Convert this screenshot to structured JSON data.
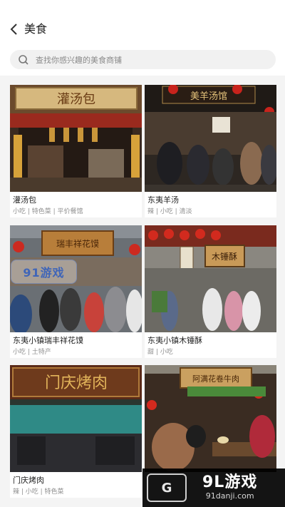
{
  "header": {
    "title": "美食",
    "back_icon": "chevron-left-icon"
  },
  "search": {
    "placeholder": "查找你感兴趣的美食商铺",
    "icon": "search-icon"
  },
  "cards": [
    {
      "name": "灌汤包",
      "tags": "小吃 | 特色菜 | 平价餐馆",
      "sign": "灌汤包"
    },
    {
      "name": "东夷羊汤",
      "tags": "辣 | 小吃 | 清淡",
      "sign": "美羊汤馆"
    },
    {
      "name": "东夷小镇瑞丰祥花馍",
      "tags": "小吃 | 土特产",
      "sign": "瑞丰祥花馍"
    },
    {
      "name": "东夷小镇木锤酥",
      "tags": "甜 | 小吃",
      "sign": "木锤酥"
    },
    {
      "name": "门庆烤肉",
      "tags": "辣 | 小吃 | 特色菜",
      "sign": "门庆烤肉"
    },
    {
      "name": "",
      "tags": "",
      "sign": "阿满花卷牛肉"
    }
  ],
  "watermarks": {
    "left": "91游戏",
    "brand": "9L游戏",
    "url": "91danji.com",
    "logo": "G"
  },
  "colors": {
    "header_bg": "#ffffff",
    "page_bg": "#f4f4f4",
    "search_bg": "#f1f1f1",
    "tag_text": "#8f8f8f"
  }
}
